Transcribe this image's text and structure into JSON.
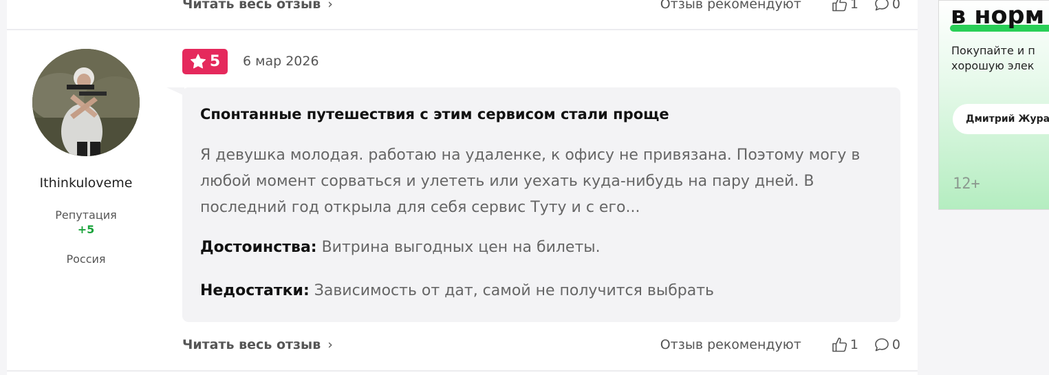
{
  "previous_review": {
    "read_full_label": "Читать весь отзыв",
    "recommend_label": "Отзыв рекомендуют",
    "likes": "1",
    "comments": "0"
  },
  "author": {
    "name": "Ithinkuloveme",
    "reputation_label": "Репутация",
    "reputation_value": "+5",
    "country": "Россия"
  },
  "review": {
    "rating": "5",
    "date": "6 мар 2026",
    "title": "Спонтанные путешествия с этим сервисом стали проще",
    "text": "Я девушка молодая. работаю на удаленке, к офису не привязана. Поэтому могу в любой момент сорваться и улететь или уехать куда-нибудь на пару дней. В последний год открыла для себя сервис Туту и с его...",
    "pros_label": "Достоинства:",
    "pros": "Витрина выгодных цен на билеты.",
    "cons_label": "Недостатки:",
    "cons": "Зависимость от дат, самой не получится выбрать",
    "read_full_label": "Читать весь отзыв",
    "recommend_label": "Отзыв рекомендуют",
    "likes": "1",
    "comments": "0"
  },
  "ad": {
    "headline": "в норм",
    "text_line1": "Покупайте и п",
    "text_line2": "хорошую элек",
    "pill": "Дмитрий Жура",
    "age": "12+"
  },
  "colors": {
    "rating_badge": "#e5295c",
    "reputation_positive": "#1aa33b",
    "card_background": "#f3f3f5",
    "ad_accent": "#29cf57"
  },
  "icons": {
    "rating": "star-icon",
    "read_more": "chevron-right-icon",
    "like": "thumbs-up-icon",
    "comment": "comment-bubble-icon"
  }
}
